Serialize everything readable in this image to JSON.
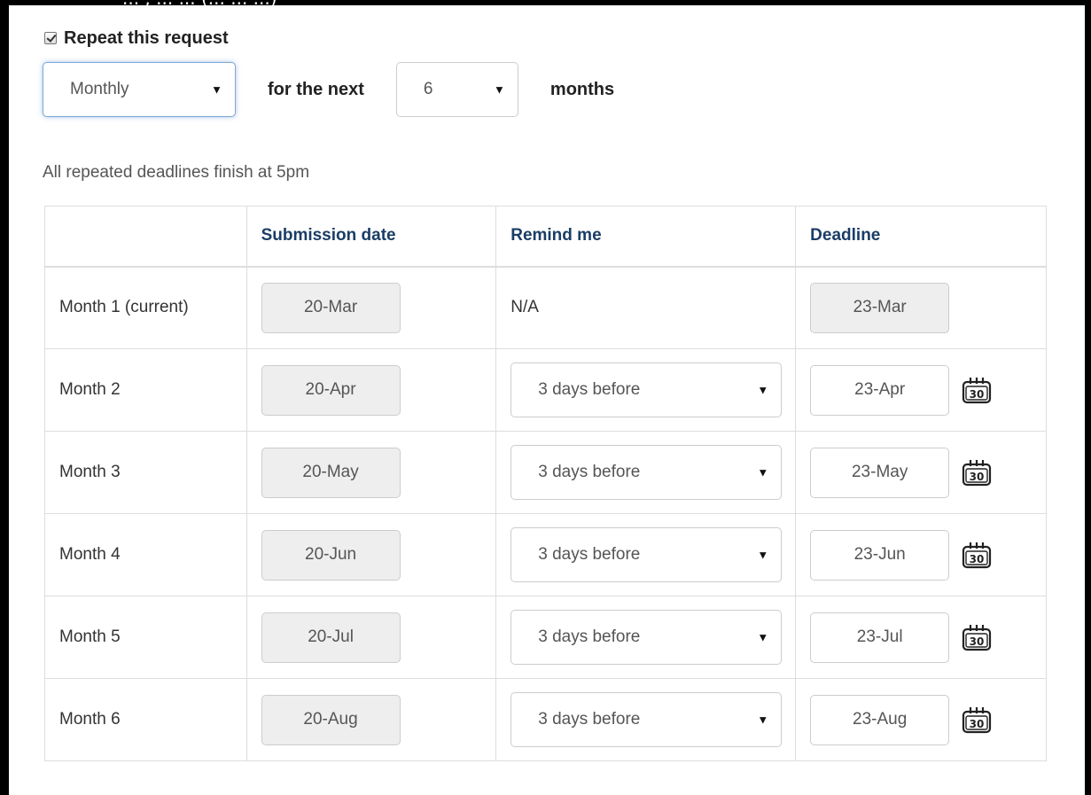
{
  "header_partial": "... , ... ... (... ... ...)",
  "repeat": {
    "checked": true,
    "label": "Repeat this request"
  },
  "frequency": {
    "selected": "Monthly",
    "connector": "for the next",
    "count": "6",
    "unit": "months"
  },
  "note": "All repeated deadlines finish at 5pm",
  "table": {
    "headers": [
      "",
      "Submission date",
      "Remind me",
      "Deadline"
    ],
    "rows": [
      {
        "label": "Month 1 (current)",
        "submission": "20-Mar",
        "remind": "N/A",
        "deadline": "23-Mar"
      },
      {
        "label": "Month 2",
        "submission": "20-Apr",
        "remind": "3 days before",
        "deadline": "23-Apr"
      },
      {
        "label": "Month 3",
        "submission": "20-May",
        "remind": "3 days before",
        "deadline": "23-May"
      },
      {
        "label": "Month 4",
        "submission": "20-Jun",
        "remind": "3 days before",
        "deadline": "23-Jun"
      },
      {
        "label": "Month 5",
        "submission": "20-Jul",
        "remind": "3 days before",
        "deadline": "23-Jul"
      },
      {
        "label": "Month 6",
        "submission": "20-Aug",
        "remind": "3 days before",
        "deadline": "23-Aug"
      }
    ]
  },
  "icons": {
    "dropdown": "chevron-down-icon",
    "calendar": "calendar-icon",
    "calendar_number": "30"
  },
  "colors": {
    "header_text": "#1a3d66",
    "focus_glow": "#7fa6d6",
    "disabled_bg": "#eeeeee"
  }
}
